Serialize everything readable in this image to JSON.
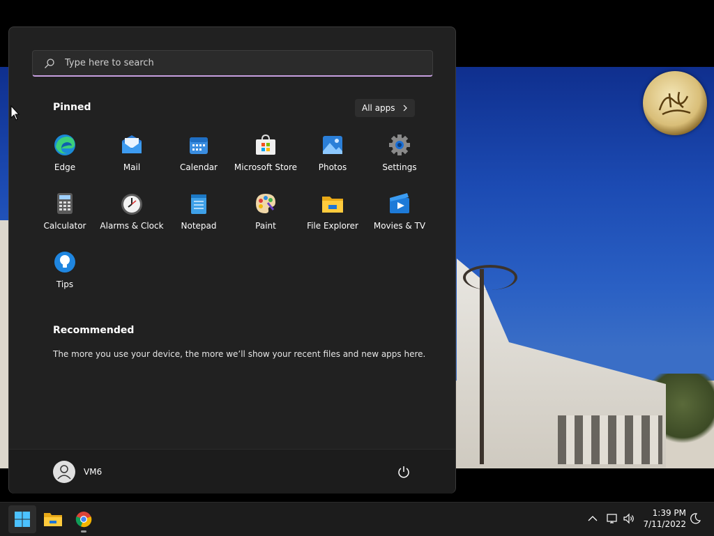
{
  "search": {
    "placeholder": "Type here to search"
  },
  "pinned": {
    "title": "Pinned",
    "all_apps_label": "All apps",
    "apps": [
      {
        "label": "Edge",
        "icon": "edge-icon"
      },
      {
        "label": "Mail",
        "icon": "mail-icon"
      },
      {
        "label": "Calendar",
        "icon": "calendar-icon"
      },
      {
        "label": "Microsoft Store",
        "icon": "store-icon"
      },
      {
        "label": "Photos",
        "icon": "photos-icon"
      },
      {
        "label": "Settings",
        "icon": "gear-icon"
      },
      {
        "label": "Calculator",
        "icon": "calculator-icon"
      },
      {
        "label": "Alarms & Clock",
        "icon": "clock-icon"
      },
      {
        "label": "Notepad",
        "icon": "notepad-icon"
      },
      {
        "label": "Paint",
        "icon": "paint-icon"
      },
      {
        "label": "File Explorer",
        "icon": "folder-icon"
      },
      {
        "label": "Movies & TV",
        "icon": "movies-icon"
      },
      {
        "label": "Tips",
        "icon": "lightbulb-icon"
      }
    ]
  },
  "recommended": {
    "title": "Recommended",
    "text": "The more you use your device, the more we’ll show your recent files and new apps here."
  },
  "user": {
    "name": "VM6"
  },
  "taskbar": {
    "time": "1:39 PM",
    "date": "7/11/2022",
    "pinned": [
      "windows-start-icon",
      "file-explorer-icon",
      "chrome-icon"
    ]
  },
  "colors": {
    "menu_bg": "#212121",
    "accent": "#c7a0e0",
    "taskbar_bg": "#1c1c1c"
  }
}
